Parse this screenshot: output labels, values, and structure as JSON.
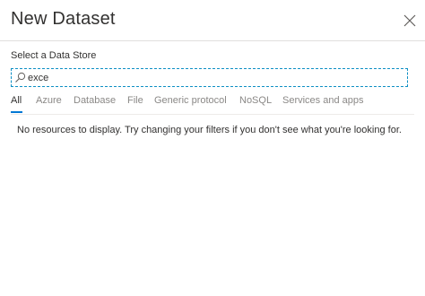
{
  "dialog": {
    "title": "New Dataset"
  },
  "store": {
    "label": "Select a Data Store"
  },
  "search": {
    "value": "exce",
    "placeholder": ""
  },
  "tabs": [
    {
      "label": "All",
      "active": true
    },
    {
      "label": "Azure"
    },
    {
      "label": "Database"
    },
    {
      "label": "File"
    },
    {
      "label": "Generic protocol"
    },
    {
      "label": "NoSQL"
    },
    {
      "label": "Services and apps"
    }
  ],
  "results": {
    "empty_message": "No resources to display. Try changing your filters if you don't see what you're looking for."
  },
  "icons": {
    "close": "close-icon",
    "search": "search-icon"
  },
  "colors": {
    "accent": "#0078d4",
    "focus_border": "#0d8fc4",
    "muted_text": "#8a8886"
  }
}
